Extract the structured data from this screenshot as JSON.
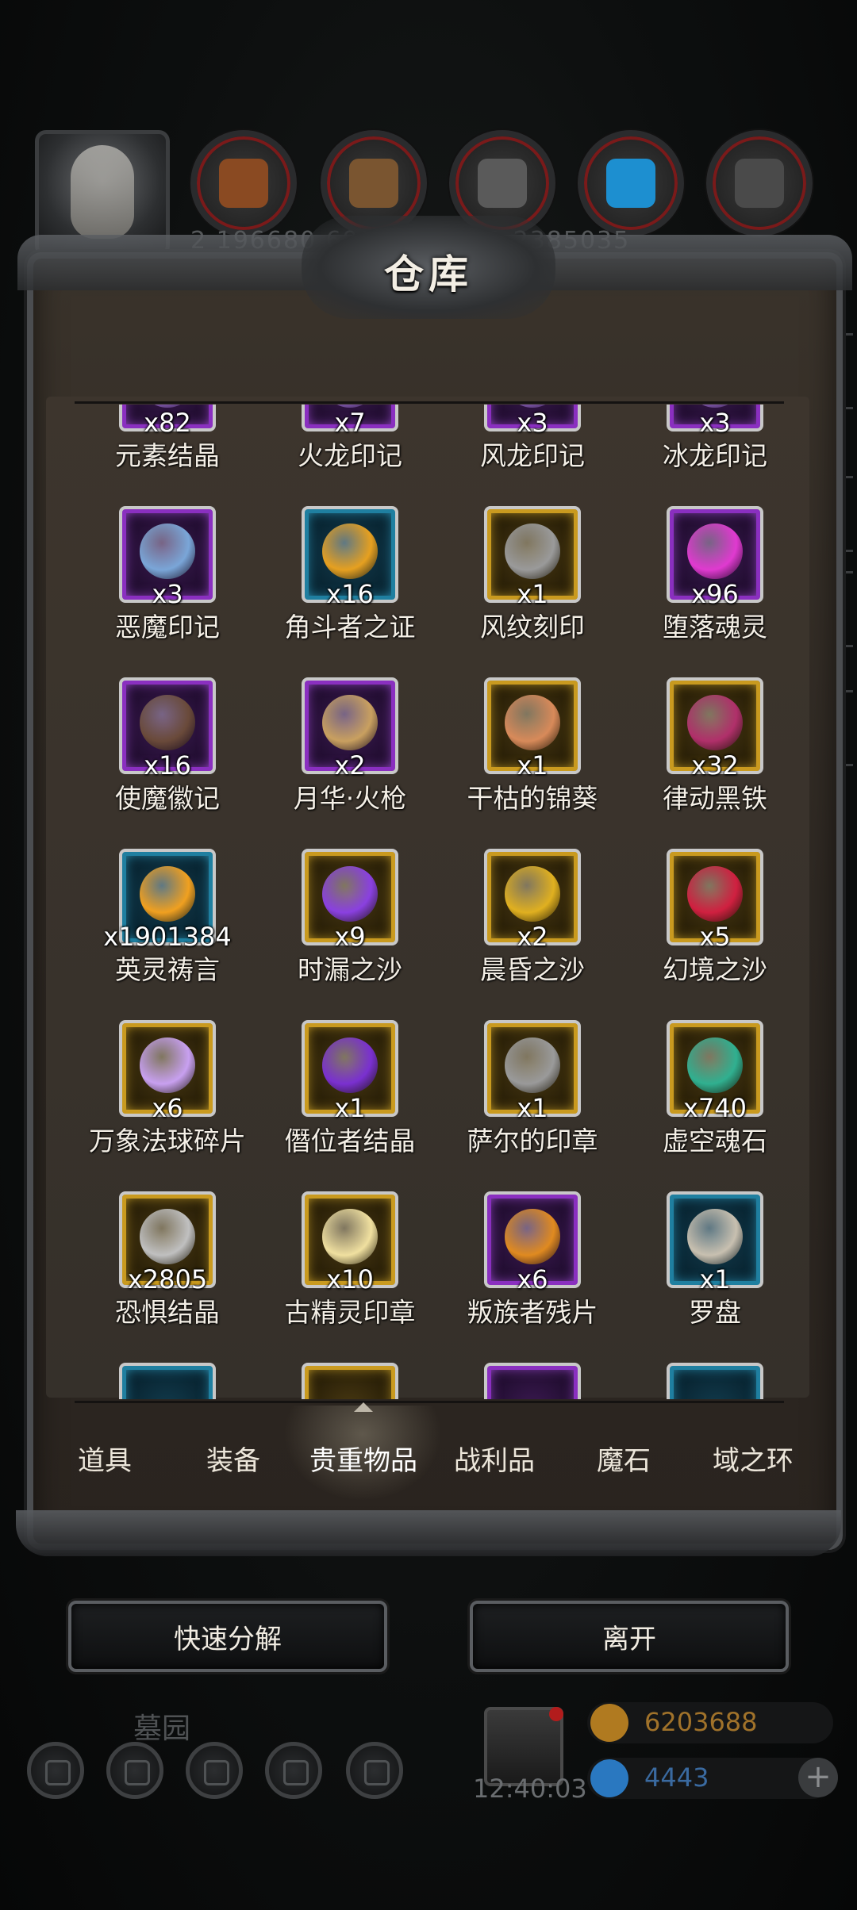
{
  "header": {
    "title": "仓库",
    "resource_numbers": "2 196680 69269 1 69 1 2385035"
  },
  "resource_icons": [
    {
      "name": "wood-resource-icon",
      "color": "#8a4a22"
    },
    {
      "name": "plank-resource-icon",
      "color": "#7a5530"
    },
    {
      "name": "iron-resource-icon",
      "color": "#5a5a5a"
    },
    {
      "name": "crystal-resource-icon",
      "color": "#1d8fd0"
    },
    {
      "name": "stone-resource-icon",
      "color": "#4a4a4a"
    }
  ],
  "items": [
    {
      "name": "元素结晶",
      "qty": "x82",
      "rarity": "purple",
      "color": "#9a6bd0"
    },
    {
      "name": "火龙印记",
      "qty": "x7",
      "rarity": "purple",
      "color": "#9a6bd0"
    },
    {
      "name": "风龙印记",
      "qty": "x3",
      "rarity": "purple",
      "color": "#9a6bd0"
    },
    {
      "name": "冰龙印记",
      "qty": "x3",
      "rarity": "purple",
      "color": "#9a6bd0"
    },
    {
      "name": "恶魔印记",
      "qty": "x3",
      "rarity": "purple",
      "color": "#7aa6d8"
    },
    {
      "name": "角斗者之证",
      "qty": "x16",
      "rarity": "blue",
      "color": "#e6a020"
    },
    {
      "name": "风纹刻印",
      "qty": "x1",
      "rarity": "gold",
      "color": "#9a9a9a"
    },
    {
      "name": "堕落魂灵",
      "qty": "x96",
      "rarity": "purple",
      "color": "#e03ad0"
    },
    {
      "name": "使魔徽记",
      "qty": "x16",
      "rarity": "purple",
      "color": "#6a4a3a"
    },
    {
      "name": "月华·火枪",
      "qty": "x2",
      "rarity": "purple",
      "color": "#c9a060"
    },
    {
      "name": "干枯的锦葵",
      "qty": "x1",
      "rarity": "gold",
      "color": "#d88a5a"
    },
    {
      "name": "律动黑铁",
      "qty": "x32",
      "rarity": "gold",
      "color": "#b0306a"
    },
    {
      "name": "英灵祷言",
      "qty": "x1901384",
      "rarity": "blue",
      "color": "#f0a020"
    },
    {
      "name": "时漏之沙",
      "qty": "x9",
      "rarity": "gold",
      "color": "#8a40e0"
    },
    {
      "name": "晨昏之沙",
      "qty": "x2",
      "rarity": "gold",
      "color": "#e0b020"
    },
    {
      "name": "幻境之沙",
      "qty": "x5",
      "rarity": "gold",
      "color": "#d02040"
    },
    {
      "name": "万象法球碎片",
      "qty": "x6",
      "rarity": "gold",
      "color": "#c8a0f0"
    },
    {
      "name": "僭位者结晶",
      "qty": "x1",
      "rarity": "gold",
      "color": "#7a30d0"
    },
    {
      "name": "萨尔的印章",
      "qty": "x1",
      "rarity": "gold",
      "color": "#9a9a9a"
    },
    {
      "name": "虚空魂石",
      "qty": "x740",
      "rarity": "gold",
      "color": "#30b090"
    },
    {
      "name": "恐惧结晶",
      "qty": "x2805",
      "rarity": "gold",
      "color": "#c0c0c0"
    },
    {
      "name": "古精灵印章",
      "qty": "x10",
      "rarity": "gold",
      "color": "#f0e0a0"
    },
    {
      "name": "叛族者残片",
      "qty": "x6",
      "rarity": "purple",
      "color": "#e08a20"
    },
    {
      "name": "罗盘",
      "qty": "x1",
      "rarity": "blue",
      "color": "#c8c0b0"
    }
  ],
  "tabs": [
    {
      "label": "道具",
      "active": false
    },
    {
      "label": "装备",
      "active": false
    },
    {
      "label": "贵重物品",
      "active": true
    },
    {
      "label": "战利品",
      "active": false
    },
    {
      "label": "魔石",
      "active": false
    },
    {
      "label": "域之环",
      "active": false
    }
  ],
  "actions": {
    "quick_decompose": "快速分解",
    "leave": "离开"
  },
  "hud": {
    "location": "墓园",
    "time": "12:40:03",
    "gold": "6203688",
    "diamonds": "4443",
    "gold_color": "#b07a20",
    "diamond_color": "#2a78c0",
    "plus": "+"
  }
}
